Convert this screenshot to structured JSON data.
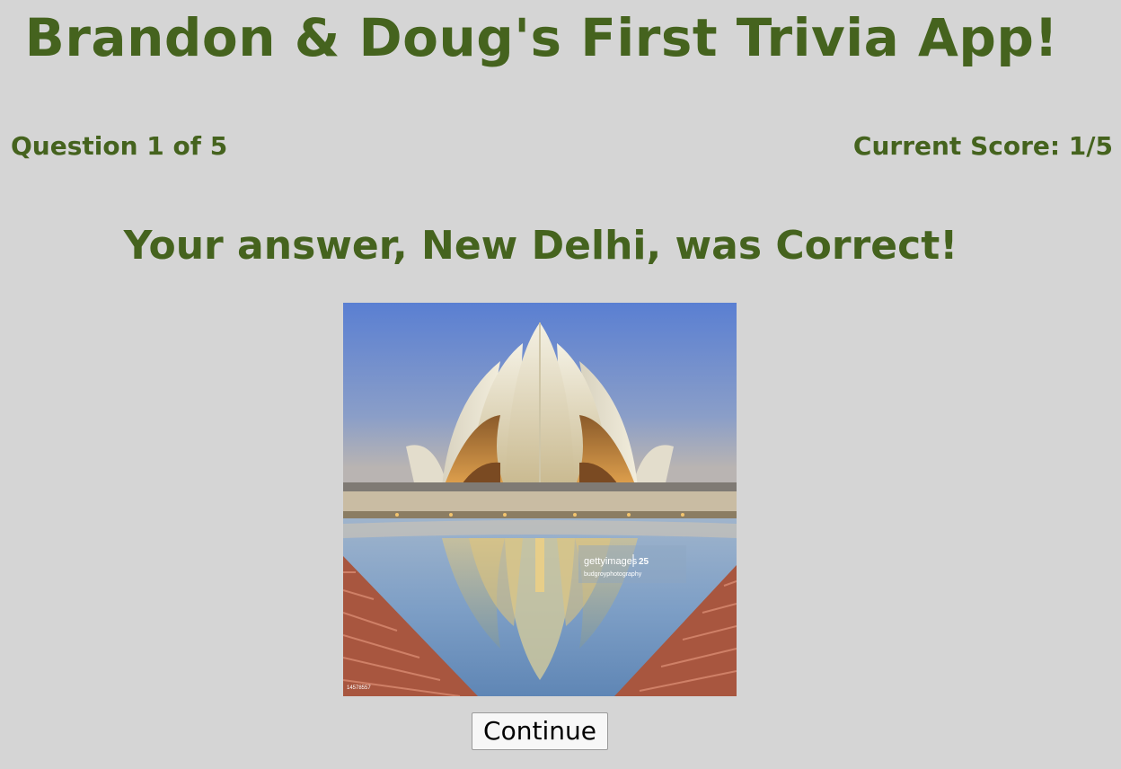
{
  "app": {
    "title": "Brandon & Doug's First Trivia App!"
  },
  "status": {
    "question_progress": "Question 1 of 5",
    "score": "Current Score: 1/5"
  },
  "result": {
    "message": "Your answer, New Delhi, was Correct!"
  },
  "image": {
    "subject": "Lotus Temple",
    "watermark_brand": "gettyimages",
    "watermark_credit": "budgroyphotography",
    "watermark_badge": "25",
    "image_id": "14578557"
  },
  "actions": {
    "continue_label": "Continue"
  },
  "colors": {
    "background": "#d5d5d5",
    "text_green": "#45631e"
  }
}
